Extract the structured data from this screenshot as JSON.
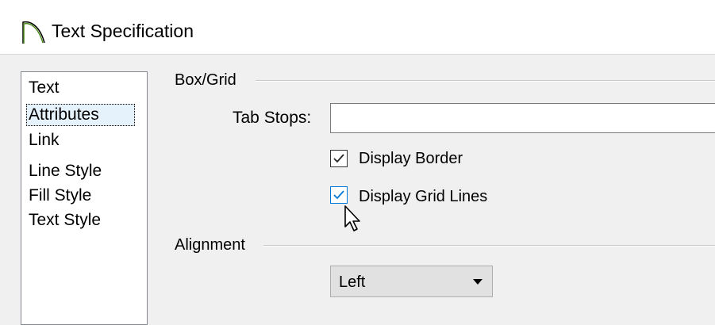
{
  "window": {
    "title": "Text Specification",
    "icon": "arc-icon"
  },
  "sidebar": {
    "items": [
      {
        "label": "Text",
        "selected": false
      },
      {
        "label": "Attributes",
        "selected": true
      },
      {
        "label": "Link",
        "selected": false
      },
      {
        "label": "Line Style",
        "selected": false
      },
      {
        "label": "Fill Style",
        "selected": false
      },
      {
        "label": "Text Style",
        "selected": false
      }
    ]
  },
  "box_grid": {
    "group_label": "Box/Grid",
    "tab_stops_label": "Tab Stops:",
    "tab_stops_value": "",
    "display_border": {
      "label": "Display Border",
      "checked": true
    },
    "display_grid_lines": {
      "label": "Display Grid Lines",
      "checked": true
    }
  },
  "alignment": {
    "group_label": "Alignment",
    "selected": "Left"
  },
  "colors": {
    "accent": "#0078d7",
    "selection": "#e5f1fb",
    "window_bg": "#f0f0f0"
  }
}
